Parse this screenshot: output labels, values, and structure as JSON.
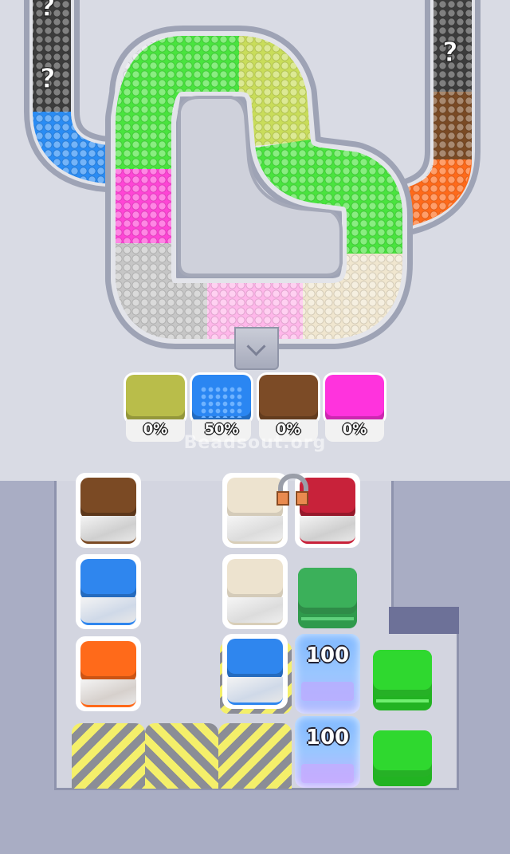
{
  "track": {
    "unknown_marker": "?",
    "segment_colors": {
      "green": "#49e43e",
      "lime": "#c9dd5a",
      "magenta": "#ff45d6",
      "gray": "#c6c6c6",
      "pink": "#ffb7ea",
      "cream": "#f0e6cf",
      "blue": "#2a8cf4",
      "orange": "#ff6a1a",
      "brown": "#7a4a24",
      "dark": "#3c3c3c"
    }
  },
  "collectors": [
    {
      "color": "#b9bd4a",
      "percent": "0%"
    },
    {
      "color": "#2a86f2",
      "percent": "50%"
    },
    {
      "color": "#7c4b26",
      "percent": "0%"
    },
    {
      "color": "#ff33dd",
      "percent": "0%"
    }
  ],
  "watermark": "Beadsout.org",
  "board": {
    "locked_counts": [
      "100",
      "100"
    ],
    "tile_colors": {
      "brown": "#7b4a24",
      "cream": "#ede3cf",
      "red": "#c8223a",
      "blue": "#2f86ee",
      "green_dark": "#3bb05a",
      "orange": "#ff6a1a",
      "green": "#2fd82f",
      "hazard_yellow": "#f4ef6a"
    }
  }
}
